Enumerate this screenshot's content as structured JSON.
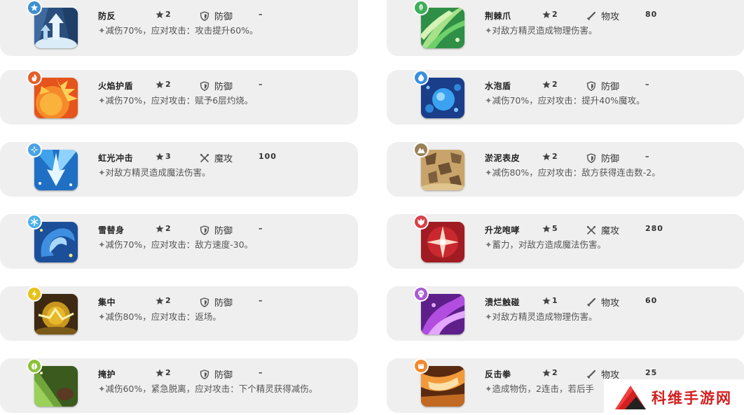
{
  "skills": [
    {
      "id": "defend",
      "name": "防反",
      "cost": "2",
      "category": "防御",
      "power": "–",
      "desc": "减伤70%，应对攻击：攻击提升60%。",
      "element": "normal",
      "art": "defend"
    },
    {
      "id": "thorn",
      "name": "荆棘爪",
      "cost": "2",
      "category": "物攻",
      "power": "80",
      "desc": "对敌方精灵造成物理伤害。",
      "element": "grass",
      "art": "thorn"
    },
    {
      "id": "fire",
      "name": "火焰护盾",
      "cost": "2",
      "category": "防御",
      "power": "–",
      "desc": "减伤70%，应对攻击：赋予6层灼烧。",
      "element": "fire",
      "art": "fire"
    },
    {
      "id": "bubble",
      "name": "水泡盾",
      "cost": "2",
      "category": "防御",
      "power": "–",
      "desc": "减伤70%，应对攻击：提升40%魔攻。",
      "element": "water",
      "art": "bubble"
    },
    {
      "id": "rainbow",
      "name": "虹光冲击",
      "cost": "3",
      "category": "魔攻",
      "power": "100",
      "desc": "对敌方精灵造成魔法伤害。",
      "element": "light",
      "art": "rainbow"
    },
    {
      "id": "mud",
      "name": "淤泥表皮",
      "cost": "2",
      "category": "防御",
      "power": "–",
      "desc": "减伤80%，应对攻击：敌方获得连击数-2。",
      "element": "ground",
      "art": "mud"
    },
    {
      "id": "snow",
      "name": "雪替身",
      "cost": "2",
      "category": "防御",
      "power": "–",
      "desc": "减伤70%，应对攻击：敌方速度-30。",
      "element": "ice",
      "art": "snow"
    },
    {
      "id": "dragon",
      "name": "升龙咆哮",
      "cost": "5",
      "category": "魔攻",
      "power": "280",
      "desc": "蓄力，对敌方造成魔法伤害。",
      "element": "dragon",
      "art": "dragon"
    },
    {
      "id": "focus",
      "name": "集中",
      "cost": "2",
      "category": "防御",
      "power": "–",
      "desc": "减伤80%，应对攻击：返场。",
      "element": "electric",
      "art": "focus"
    },
    {
      "id": "rot",
      "name": "溃烂触碰",
      "cost": "1",
      "category": "物攻",
      "power": "60",
      "desc": "对敌方精灵造成物理伤害。",
      "element": "poison",
      "art": "rot"
    },
    {
      "id": "cover",
      "name": "掩护",
      "cost": "2",
      "category": "防御",
      "power": "–",
      "desc": "减伤60%，紧急脱离，应对攻击：下个精灵获得减伤。",
      "element": "bug",
      "art": "cover"
    },
    {
      "id": "counter",
      "name": "反击拳",
      "cost": "2",
      "category": "物攻",
      "power": "25",
      "desc": "造成物伤，2连击，若后手",
      "element": "fighting",
      "art": "counter"
    }
  ],
  "element_colors": {
    "normal": "#3d8fd1",
    "grass": "#3fae5a",
    "fire": "#e2602a",
    "water": "#3c8fe0",
    "light": "#4aa3e6",
    "ground": "#9a8058",
    "ice": "#4bb0e8",
    "dragon": "#d8424a",
    "electric": "#e8c21c",
    "poison": "#a85bd0",
    "bug": "#8cc13a",
    "fighting": "#f08a30"
  },
  "icons": {
    "cost": "star-icon",
    "defense": "shield-icon",
    "physical": "sword-icon",
    "magic": "crossed-swords-icon",
    "bullet": "✦"
  },
  "watermark": {
    "text": "科维手游网",
    "logo": "triangle-logo"
  }
}
